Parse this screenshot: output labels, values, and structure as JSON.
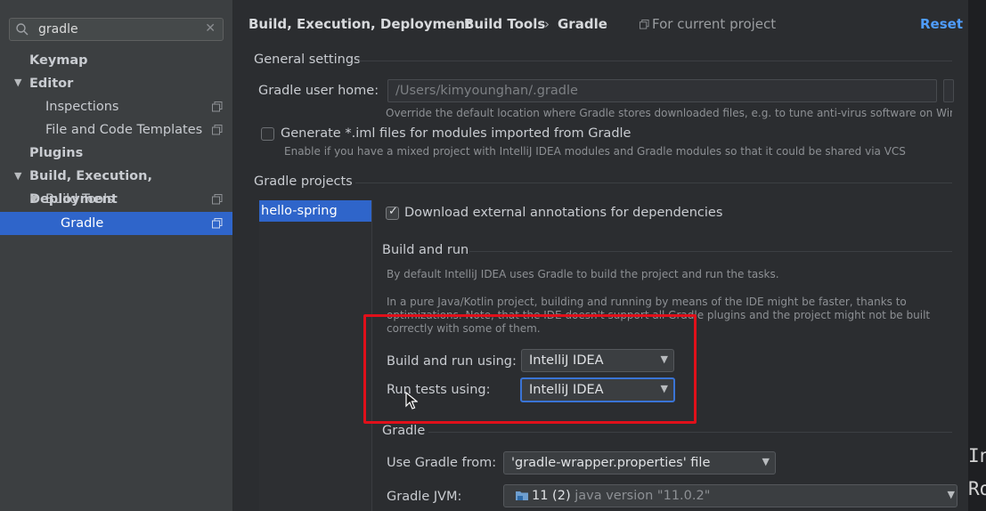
{
  "sidebar": {
    "search": {
      "value": "gradle",
      "icon": "search-icon",
      "clear_icon": "close-icon"
    },
    "items": [
      {
        "label": "Keymap",
        "bold": true
      },
      {
        "label": "Editor",
        "bold": true,
        "expanded": true
      },
      {
        "label": "Inspections",
        "icon": "copy-icon"
      },
      {
        "label": "File and Code Templates",
        "icon": "copy-icon"
      },
      {
        "label": "Plugins",
        "bold": true
      },
      {
        "label": "Build, Execution, Deployment",
        "bold": true,
        "expanded": true
      },
      {
        "label": "Build Tools",
        "expanded": true,
        "icon": "copy-icon"
      },
      {
        "label": "Gradle",
        "selected": true,
        "icon": "copy-icon"
      }
    ]
  },
  "header": {
    "breadcrumb": [
      "Build, Execution, Deployment",
      "Build Tools",
      "Gradle"
    ],
    "separator": "›",
    "scope": "For current project",
    "reset": "Reset"
  },
  "general": {
    "title": "General settings",
    "user_home_label": "Gradle user home:",
    "user_home_value": "/Users/kimyounghan/.gradle",
    "user_home_hint": "Override the default location where Gradle stores downloaded files, e.g. to tune anti-virus software on Windo",
    "iml_label": "Generate *.iml files for modules imported from Gradle",
    "iml_checked": false,
    "iml_hint": "Enable if you have a mixed project with IntelliJ IDEA modules and Gradle modules so that it could be shared via VCS"
  },
  "projects": {
    "title": "Gradle projects",
    "list": [
      "hello-spring"
    ],
    "download_annotations_label": "Download external annotations for dependencies",
    "download_annotations_checked": true
  },
  "build_and_run": {
    "title": "Build and run",
    "hint1": "By default IntelliJ IDEA uses Gradle to build the project and run the tasks.",
    "hint2_line1": "In a pure Java/Kotlin project, building and running by means of the IDE might be faster, thanks to",
    "hint2_line2": "optimizations. Note, that the IDE doesn't support all Gradle plugins and the project might not be built",
    "hint2_line3": "correctly with some of them.",
    "build_run_label": "Build and run using:",
    "build_run_value": "IntelliJ IDEA",
    "tests_label": "Run tests using:",
    "tests_value": "IntelliJ IDEA"
  },
  "gradle": {
    "title": "Gradle",
    "use_from_label": "Use Gradle from:",
    "use_from_value": "'gradle-wrapper.properties' file",
    "jvm_label": "Gradle JVM:",
    "jvm_value_prefix": "11 (2)",
    "jvm_value_suffix": "java version \"11.0.2\""
  },
  "editor_edge": {
    "line1": "In",
    "line2": "Ro"
  },
  "colors": {
    "accent": "#2f65ca",
    "link": "#4f9dff",
    "highlight": "#e0101a"
  }
}
